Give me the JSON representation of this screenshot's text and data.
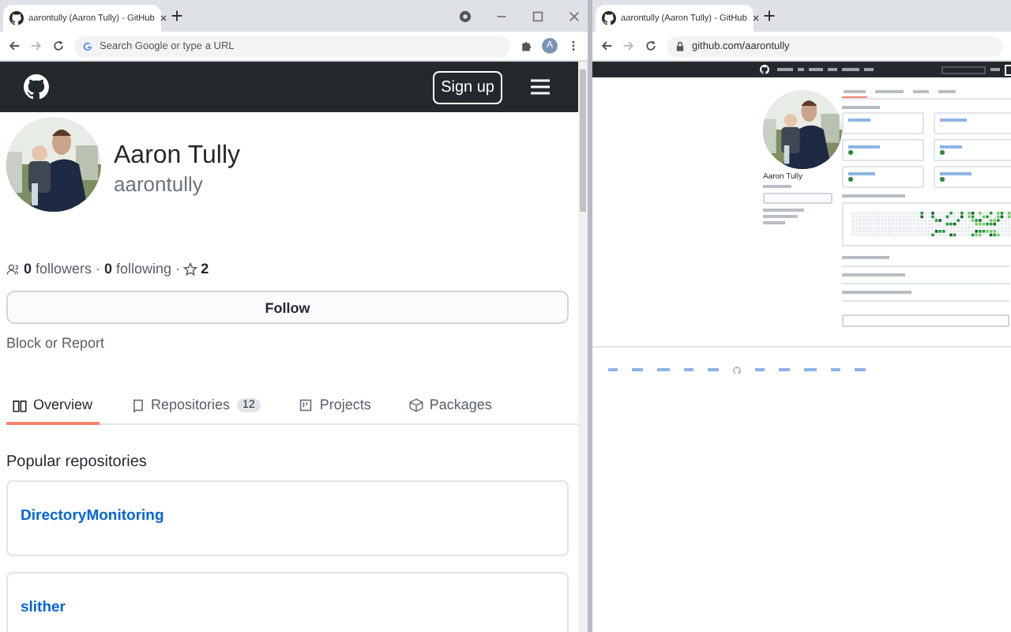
{
  "left_window": {
    "tab": {
      "title": "aarontully (Aaron Tully) - GitHub"
    },
    "address": {
      "placeholder": "Search Google or type a URL"
    },
    "account_initial": "A",
    "header": {
      "sign_up": "Sign up"
    },
    "profile": {
      "name": "Aaron Tully",
      "login": "aarontully",
      "stats": "**0** followers · **0** following ·",
      "stars": "2",
      "follow": "Follow",
      "block": "Block or Report"
    },
    "tabs": [
      {
        "label": "Overview",
        "selected": true
      },
      {
        "label": "Repositories",
        "count": "12",
        "selected": false
      },
      {
        "label": "Projects",
        "selected": false
      },
      {
        "label": "Packages",
        "selected": false
      }
    ],
    "popular_heading": "Popular repositories",
    "repos": [
      {
        "name": "DirectoryMonitoring"
      },
      {
        "name": "slither"
      }
    ]
  },
  "right_window": {
    "tab": {
      "title": "aarontully (Aaron Tully) - GitHub"
    },
    "address": {
      "value": "github.com/aarontully"
    },
    "profile": {
      "name": "Aaron Tully"
    },
    "tabs": [
      {
        "selected": true
      },
      {
        "selected": false
      },
      {
        "selected": false
      },
      {
        "selected": false
      }
    ],
    "repos": [
      {
        "language": false
      },
      {
        "language": false
      },
      {
        "language": true
      },
      {
        "language": true
      },
      {
        "language": true
      },
      {
        "language": true
      }
    ]
  }
}
